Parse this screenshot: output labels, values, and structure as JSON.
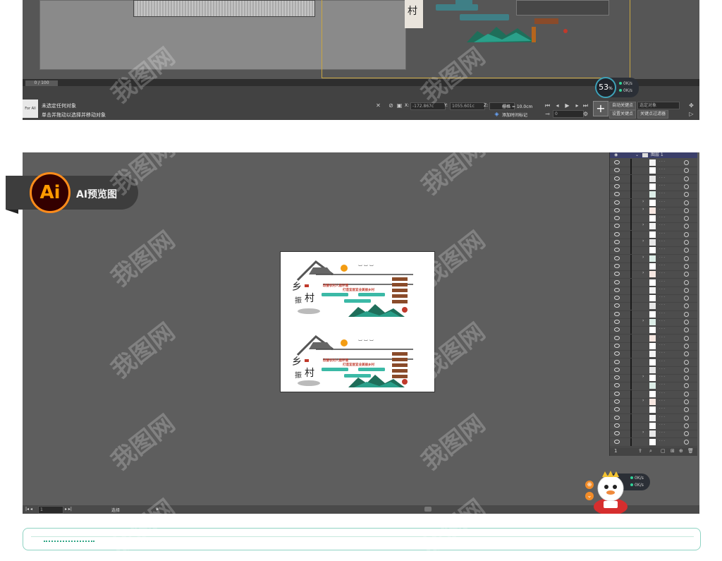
{
  "max_panel": {
    "timeline_counter": "0 / 100",
    "status_line_1": "未选定任何对象",
    "status_line_2": "单击并拖动以选择并移动对象",
    "thumb_label": "For All",
    "x_label": "X:",
    "x_value": "-172.867c",
    "y_label": "Y:",
    "y_value": "1055.601c",
    "z_label": "Z:",
    "grid_label": "栅格 = 10.0cm",
    "auto_key": "自动关键点",
    "set_key": "设置关键点",
    "selected_object": "选定对象",
    "key_filter": "关键点过滤器",
    "add_time_tag": "添加时间标记",
    "frame_value": "0",
    "gauge_percent": "53",
    "gauge_unit": "%",
    "speed_up": "0K/s",
    "speed_down": "0K/s"
  },
  "ai_panel": {
    "logo_text": "Ai",
    "badge_label": "AI预览图",
    "layer_name": "图层 1",
    "zoom_value": "1",
    "tool_status": "选择",
    "speed_up": "0K/s",
    "speed_down": "0K/s"
  },
  "artwork": {
    "village_char_1": "乡",
    "village_char_2": "村",
    "village_char_3": "振",
    "banner_line_1": "改善农村人居环境",
    "banner_line_2": "打造宜居宜业美丽乡村"
  },
  "watermark": "我图网",
  "colors": {
    "ai_orange": "#ff9a00",
    "teal": "#3bb9a6",
    "accent_red": "#c0392b",
    "brown": "#8a4b2a",
    "gold_frame": "#c9a640"
  }
}
